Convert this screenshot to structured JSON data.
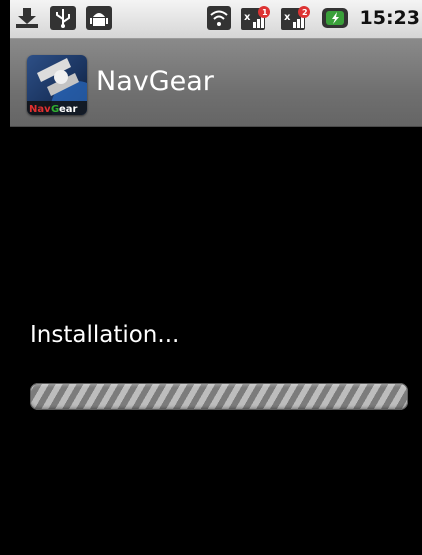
{
  "status_bar": {
    "left_icons": [
      "download-icon",
      "usb-icon",
      "android-debug-icon"
    ],
    "right_icons": [
      "wifi-icon",
      "signal-1-icon",
      "signal-2-icon",
      "battery-icon"
    ],
    "time": "15:23"
  },
  "app_bar": {
    "icon_text": "NavGear",
    "title": "NavGear"
  },
  "content": {
    "status_text": "Installation...",
    "progress_indeterminate": true
  }
}
